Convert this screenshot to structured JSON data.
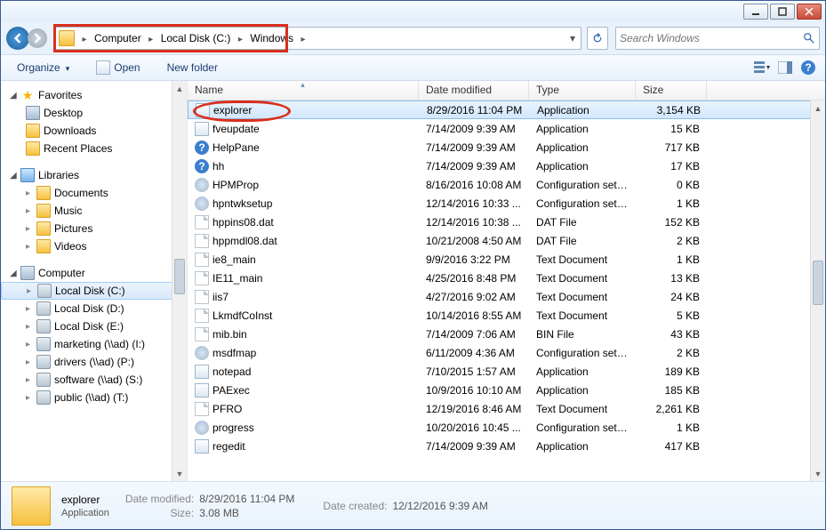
{
  "breadcrumb": {
    "seg0": "Computer",
    "seg1": "Local Disk (C:)",
    "seg2": "Windows"
  },
  "search": {
    "placeholder": "Search Windows"
  },
  "toolbar": {
    "organize": "Organize",
    "open": "Open",
    "newfolder": "New folder"
  },
  "sidebar": {
    "favorites": {
      "label": "Favorites",
      "desktop": "Desktop",
      "downloads": "Downloads",
      "recent": "Recent Places"
    },
    "libraries": {
      "label": "Libraries",
      "documents": "Documents",
      "music": "Music",
      "pictures": "Pictures",
      "videos": "Videos"
    },
    "computer": {
      "label": "Computer",
      "d0": "Local Disk (C:)",
      "d1": "Local Disk (D:)",
      "d2": "Local Disk (E:)",
      "d3": "marketing (\\\\ad) (I:)",
      "d4": "drivers (\\\\ad) (P:)",
      "d5": "software (\\\\ad) (S:)",
      "d6": "public (\\\\ad) (T:)"
    }
  },
  "columns": {
    "name": "Name",
    "date": "Date modified",
    "type": "Type",
    "size": "Size"
  },
  "files": {
    "r0": {
      "n": "explorer",
      "d": "8/29/2016 11:04 PM",
      "t": "Application",
      "s": "3,154 KB",
      "i": "app"
    },
    "r1": {
      "n": "fveupdate",
      "d": "7/14/2009 9:39 AM",
      "t": "Application",
      "s": "15 KB",
      "i": "app"
    },
    "r2": {
      "n": "HelpPane",
      "d": "7/14/2009 9:39 AM",
      "t": "Application",
      "s": "717 KB",
      "i": "help"
    },
    "r3": {
      "n": "hh",
      "d": "7/14/2009 9:39 AM",
      "t": "Application",
      "s": "17 KB",
      "i": "help"
    },
    "r4": {
      "n": "HPMProp",
      "d": "8/16/2016 10:08 AM",
      "t": "Configuration sett...",
      "s": "0 KB",
      "i": "gear"
    },
    "r5": {
      "n": "hpntwksetup",
      "d": "12/14/2016 10:33 ...",
      "t": "Configuration sett...",
      "s": "1 KB",
      "i": "gear"
    },
    "r6": {
      "n": "hppins08.dat",
      "d": "12/14/2016 10:38 ...",
      "t": "DAT File",
      "s": "152 KB",
      "i": "doc"
    },
    "r7": {
      "n": "hppmdl08.dat",
      "d": "10/21/2008 4:50 AM",
      "t": "DAT File",
      "s": "2 KB",
      "i": "doc"
    },
    "r8": {
      "n": "ie8_main",
      "d": "9/9/2016 3:22 PM",
      "t": "Text Document",
      "s": "1 KB",
      "i": "doc"
    },
    "r9": {
      "n": "IE11_main",
      "d": "4/25/2016 8:48 PM",
      "t": "Text Document",
      "s": "13 KB",
      "i": "doc"
    },
    "r10": {
      "n": "iis7",
      "d": "4/27/2016 9:02 AM",
      "t": "Text Document",
      "s": "24 KB",
      "i": "doc"
    },
    "r11": {
      "n": "LkmdfCoInst",
      "d": "10/14/2016 8:55 AM",
      "t": "Text Document",
      "s": "5 KB",
      "i": "doc"
    },
    "r12": {
      "n": "mib.bin",
      "d": "7/14/2009 7:06 AM",
      "t": "BIN File",
      "s": "43 KB",
      "i": "doc"
    },
    "r13": {
      "n": "msdfmap",
      "d": "6/11/2009 4:36 AM",
      "t": "Configuration sett...",
      "s": "2 KB",
      "i": "gear"
    },
    "r14": {
      "n": "notepad",
      "d": "7/10/2015 1:57 AM",
      "t": "Application",
      "s": "189 KB",
      "i": "app"
    },
    "r15": {
      "n": "PAExec",
      "d": "10/9/2016 10:10 AM",
      "t": "Application",
      "s": "185 KB",
      "i": "app"
    },
    "r16": {
      "n": "PFRO",
      "d": "12/19/2016 8:46 AM",
      "t": "Text Document",
      "s": "2,261 KB",
      "i": "doc"
    },
    "r17": {
      "n": "progress",
      "d": "10/20/2016 10:45 ...",
      "t": "Configuration sett...",
      "s": "1 KB",
      "i": "gear"
    },
    "r18": {
      "n": "regedit",
      "d": "7/14/2009 9:39 AM",
      "t": "Application",
      "s": "417 KB",
      "i": "app"
    }
  },
  "details": {
    "name": "explorer",
    "type": "Application",
    "lbl_mod": "Date modified:",
    "mod": "8/29/2016 11:04 PM",
    "lbl_size": "Size:",
    "size": "3.08 MB",
    "lbl_created": "Date created:",
    "created": "12/12/2016 9:39 AM"
  }
}
